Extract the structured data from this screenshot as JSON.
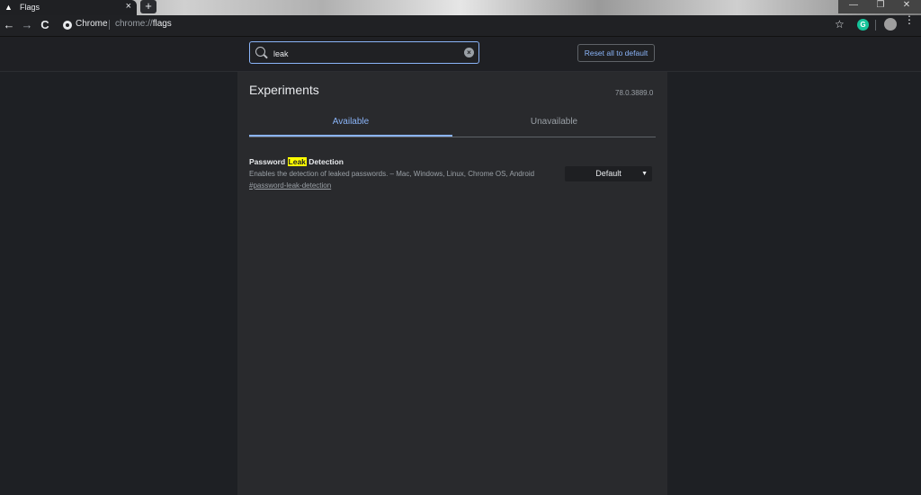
{
  "window": {
    "tab_title": "Flags",
    "tab_close": "×",
    "new_tab": "+",
    "controls": {
      "minimize": "—",
      "maximize": "❐",
      "close": "✕"
    }
  },
  "toolbar": {
    "back": "←",
    "forward": "→",
    "reload": "C",
    "site_label": "Chrome",
    "url_scheme": "chrome://",
    "url_host": "flags",
    "star": "☆",
    "extension_label": "G",
    "menu": "⋮"
  },
  "search": {
    "value": "leak",
    "clear": "×"
  },
  "reset_button": "Reset all to default",
  "page": {
    "title": "Experiments",
    "version": "78.0.3889.0"
  },
  "tabs": {
    "available": "Available",
    "unavailable": "Unavailable"
  },
  "experiment": {
    "name_before": "Password ",
    "name_match": "Leak",
    "name_after": " Detection",
    "description": "Enables the detection of leaked passwords. – Mac, Windows, Linux, Chrome OS, Android",
    "link": "#password-leak-detection",
    "selected_option": "Default",
    "caret": "▼"
  },
  "colors": {
    "accent": "#8ab4f8",
    "highlight": "#ffff00",
    "panel_bg": "#292a2d",
    "page_bg": "#1e2024"
  }
}
